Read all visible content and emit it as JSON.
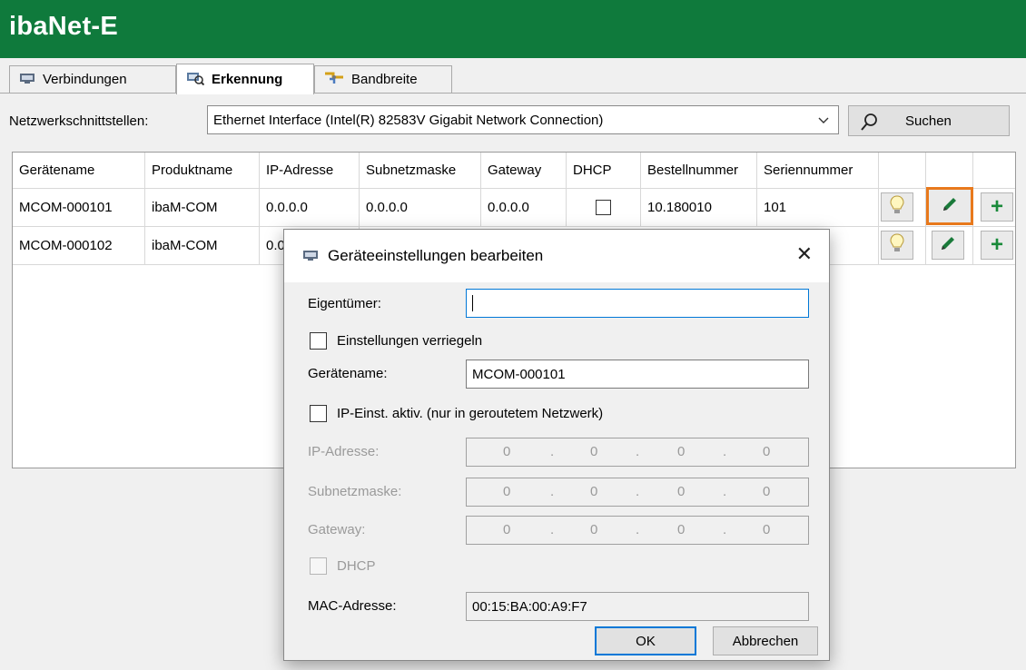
{
  "app": {
    "title": "ibaNet-E"
  },
  "tabs": [
    {
      "label": "Verbindungen",
      "icon": "network-icon"
    },
    {
      "label": "Erkennung",
      "icon": "discovery-icon"
    },
    {
      "label": "Bandbreite",
      "icon": "bandwidth-icon"
    }
  ],
  "nic": {
    "label": "Netzwerkschnittstellen:",
    "value": "Ethernet Interface (Intel(R) 82583V Gigabit Network Connection)"
  },
  "search_button": "Suchen",
  "table": {
    "headers": [
      "Gerätename",
      "Produktname",
      "IP-Adresse",
      "Subnetzmaske",
      "Gateway",
      "DHCP",
      "Bestellnummer",
      "Seriennummer"
    ],
    "rows": [
      {
        "name": "MCOM-000101",
        "product": "ibaM-COM",
        "ip": "0.0.0.0",
        "subnet": "0.0.0.0",
        "gateway": "0.0.0.0",
        "dhcp": false,
        "order": "10.180010",
        "serial": "101"
      },
      {
        "name": "MCOM-000102",
        "product": "ibaM-COM",
        "ip": "0.0.0.0",
        "subnet": "",
        "gateway": "",
        "dhcp": false,
        "order": "",
        "serial": ""
      }
    ]
  },
  "dialog": {
    "title": "Geräteeinstellungen bearbeiten",
    "owner_label": "Eigentümer:",
    "owner_value": "",
    "lock_label": "Einstellungen verriegeln",
    "name_label": "Gerätename:",
    "name_value": "MCOM-000101",
    "ip_active_label": "IP-Einst. aktiv. (nur in geroutetem Netzwerk)",
    "ip_label": "IP-Adresse:",
    "subnet_label": "Subnetzmaske:",
    "gateway_label": "Gateway:",
    "octets": [
      "0",
      "0",
      "0",
      "0"
    ],
    "dhcp_label": "DHCP",
    "mac_label": "MAC-Adresse:",
    "mac_value": "00:15:BA:00:A9:F7",
    "ok": "OK",
    "cancel": "Abbrechen"
  },
  "colors": {
    "titlebar": "#0f7a3c",
    "highlight": "#e8791c",
    "accent_blue": "#0078d7"
  }
}
